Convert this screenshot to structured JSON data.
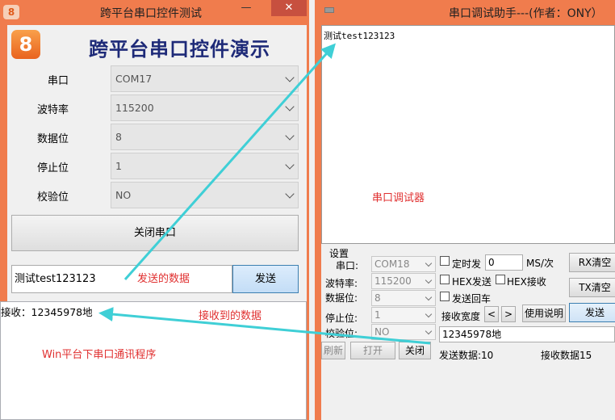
{
  "left_window": {
    "title": "跨平台串口控件测试",
    "logo_glyph": "8",
    "minimize": "—",
    "close": "✕",
    "app_title": "跨平台串口控件演示",
    "fields": [
      {
        "label": "串口",
        "value": "COM17"
      },
      {
        "label": "波特率",
        "value": "115200"
      },
      {
        "label": "数据位",
        "value": "8"
      },
      {
        "label": "停止位",
        "value": "1"
      },
      {
        "label": "校验位",
        "value": "NO"
      }
    ],
    "close_port_label": "关闭串口",
    "send_input_value": "测试test123123",
    "send_button": "发送",
    "received_text": "接收：12345978地"
  },
  "right_window": {
    "title": "串口调试助手---(作者：ONY）",
    "terminal_text": "测试test123123",
    "settings": {
      "group_label": "设置",
      "fields": [
        {
          "label": "串口:",
          "value": "COM18"
        },
        {
          "label": "波特率:",
          "value": "115200"
        },
        {
          "label": "数据位:",
          "value": "8"
        },
        {
          "label": "停止位:",
          "value": "1"
        },
        {
          "label": "校验位:",
          "value": "NO"
        }
      ],
      "refresh": "刷新",
      "open": "打开",
      "close": "关闭"
    },
    "timed_send_label": "定时发",
    "timed_interval": "0",
    "interval_unit": "MS/次",
    "hex_send_label": "HEX发送",
    "hex_recv_label": "HEX接收",
    "send_enter_label": "发送回车",
    "recv_width_label": "接收宽度",
    "width_dec": "<",
    "width_inc": ">",
    "help_button": "使用说明",
    "rx_clear": "RX清空",
    "tx_clear": "TX清空",
    "send_button": "发送",
    "send_input": "12345978地",
    "sent_count": "发送数据:10",
    "recv_count": "接收数据15"
  },
  "annotations": {
    "serial_debugger": "串口调试器",
    "sent_data": "发送的数据",
    "received_data": "接收到的数据",
    "win_program": "Win平台下串口通讯程序"
  },
  "colors": {
    "window_frame": "#f07c4d",
    "arrow": "#3fcfd6",
    "annotation_red": "#e03030",
    "title_navy": "#1e2a78"
  }
}
